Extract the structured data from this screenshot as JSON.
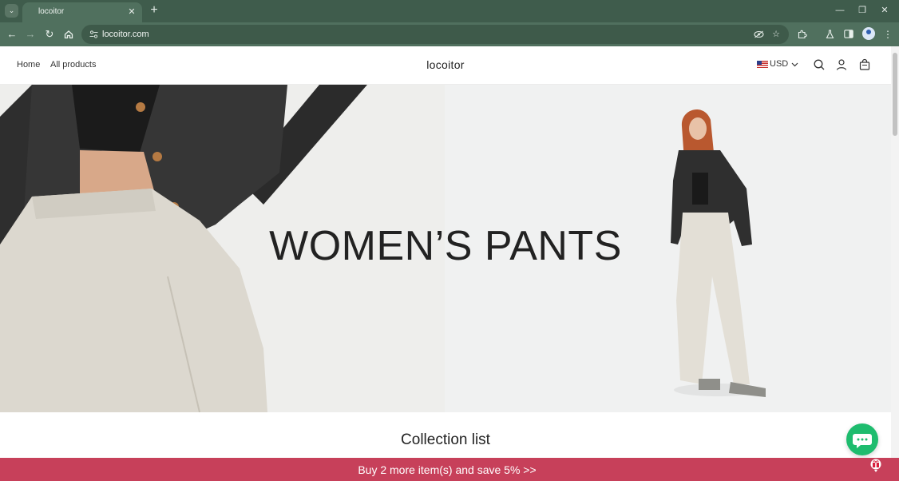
{
  "browser": {
    "tab_title": "locoitor",
    "url": "locoitor.com",
    "icons": {
      "tab_menu": "chevron-down-icon",
      "tab_close": "close-icon",
      "new_tab": "plus-icon",
      "minimize": "minimize-icon",
      "restore": "restore-icon",
      "close_window": "close-icon",
      "back": "arrow-left-icon",
      "forward": "arrow-right-icon",
      "reload": "reload-icon",
      "home": "home-icon",
      "site_info": "tune-icon",
      "eye_off": "eye-off-icon",
      "bookmark": "star-icon",
      "extensions": "puzzle-icon",
      "labs": "flask-icon",
      "side_panel": "side-panel-icon",
      "profile": "profile-icon",
      "menu": "kebab-menu-icon"
    },
    "chrome_color": "#50705e"
  },
  "header": {
    "nav": [
      {
        "label": "Home"
      },
      {
        "label": "All products"
      }
    ],
    "brand": "locoitor",
    "currency": "USD",
    "icons": [
      "us-flag-icon",
      "search-icon",
      "account-icon",
      "cart-icon"
    ]
  },
  "hero": {
    "title": "WOMEN’S PANTS"
  },
  "collection": {
    "title": "Collection list"
  },
  "promo": {
    "text": "Buy 2 more item(s) and save 5%  >>",
    "color": "#c7405a"
  },
  "chat": {
    "icon": "chat-bubble-icon",
    "color": "#1ebc6e"
  }
}
